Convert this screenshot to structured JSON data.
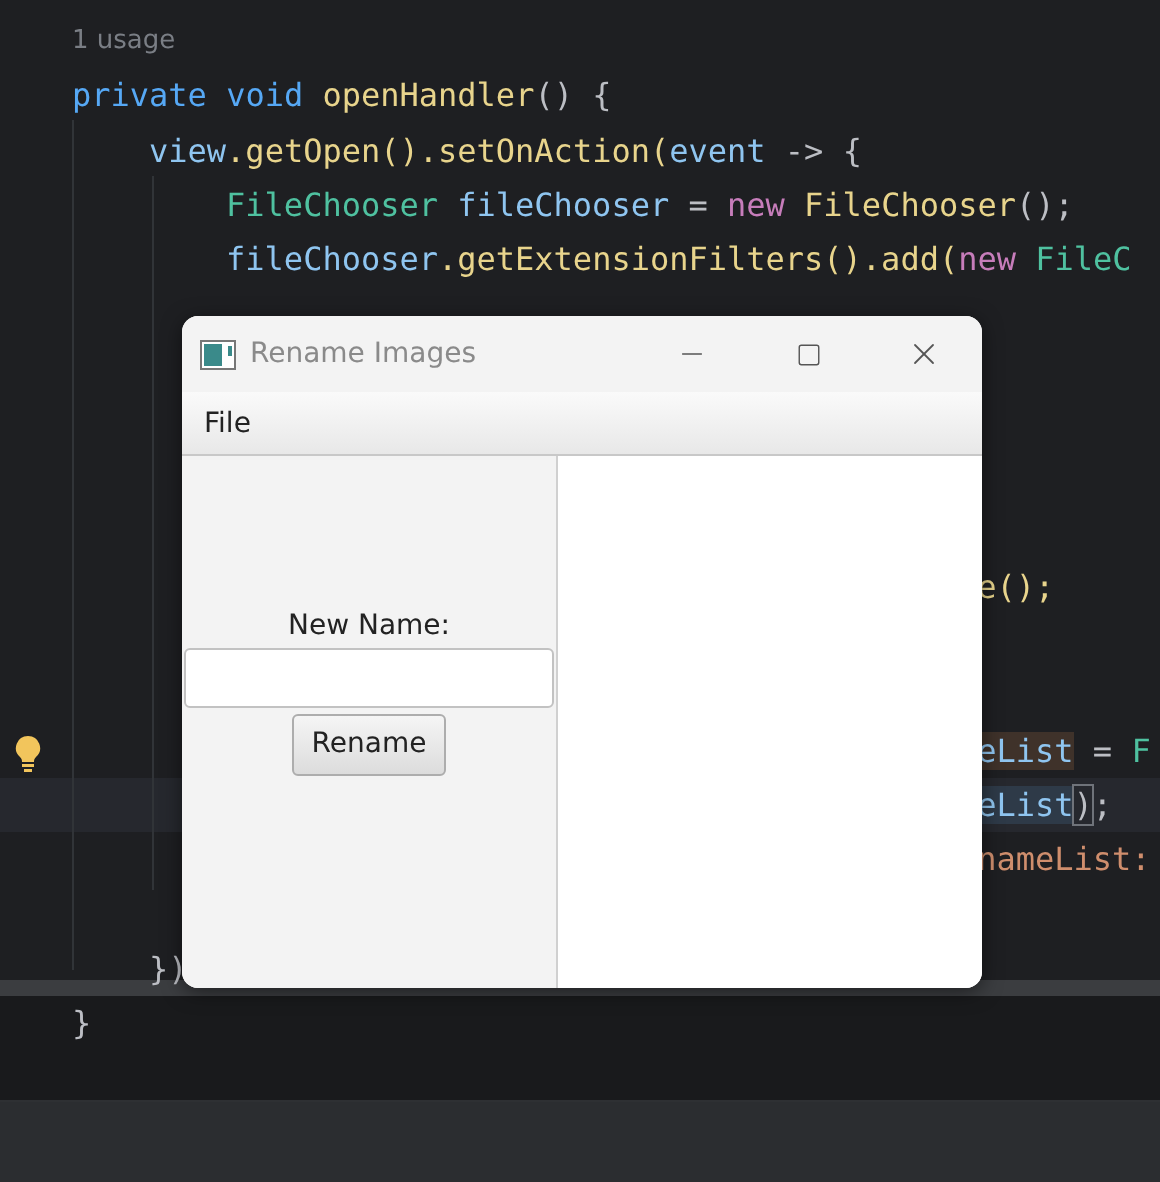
{
  "editor": {
    "usage_hint": "1 usage",
    "lines": [
      {
        "current": false,
        "segments": [
          {
            "text": "private ",
            "kind": "keyword"
          },
          {
            "text": "void ",
            "kind": "keyword"
          },
          {
            "text": "openHandler",
            "kind": "method"
          },
          {
            "text": "() {",
            "kind": "plain"
          }
        ]
      },
      {
        "current": false,
        "segments": [
          {
            "text": "view",
            "kind": "field"
          },
          {
            "text": ".getOpen().setOnAction(",
            "kind": "method"
          },
          {
            "text": "event",
            "kind": "field"
          },
          {
            "text": " -> {",
            "kind": "plain"
          }
        ]
      },
      {
        "current": false,
        "segments": [
          {
            "text": "FileChooser ",
            "kind": "type"
          },
          {
            "text": "fileChooser",
            "kind": "field"
          },
          {
            "text": " = ",
            "kind": "plain"
          },
          {
            "text": "new ",
            "kind": "new"
          },
          {
            "text": "FileChooser",
            "kind": "method"
          },
          {
            "text": "();",
            "kind": "plain"
          }
        ]
      },
      {
        "current": false,
        "segments": [
          {
            "text": "fileChooser",
            "kind": "field"
          },
          {
            "text": ".getExtensionFilters().add(",
            "kind": "method"
          },
          {
            "text": "new ",
            "kind": "new"
          },
          {
            "text": "FileC",
            "kind": "type"
          }
        ]
      },
      {
        "current": false,
        "segments": [
          {
            "text": "e();",
            "kind": "method"
          }
        ]
      },
      {
        "current": false,
        "segments": [
          {
            "text": "eList",
            "kind": "usage"
          },
          {
            "text": " = ",
            "kind": "plain"
          },
          {
            "text": "F",
            "kind": "type"
          }
        ]
      },
      {
        "current": true,
        "segments": [
          {
            "text": "eList",
            "kind": "read"
          },
          {
            "text": ")",
            "kind": "brace"
          },
          {
            "text": ";",
            "kind": "plain"
          }
        ]
      },
      {
        "current": false,
        "segments": [
          {
            "text": "nameList:",
            "kind": "param"
          }
        ]
      },
      {
        "current": false,
        "segments": [
          {
            "text": "})",
            "kind": "plain"
          }
        ]
      },
      {
        "current": false,
        "segments": [
          {
            "text": "}",
            "kind": "plain"
          }
        ]
      }
    ]
  },
  "window": {
    "title": "Rename Images",
    "menu": [
      "File"
    ],
    "label": "New Name:",
    "button": "Rename"
  }
}
